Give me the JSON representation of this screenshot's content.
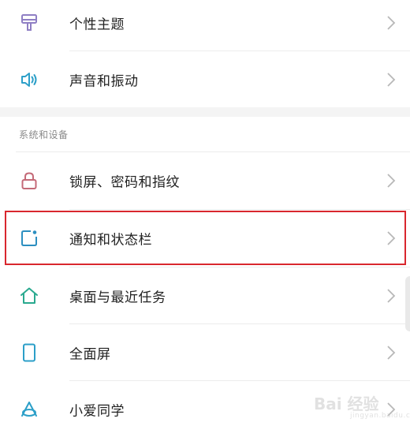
{
  "section_top": {
    "items": [
      {
        "label": "个性主题",
        "icon": "theme-icon"
      },
      {
        "label": "声音和振动",
        "icon": "sound-icon"
      }
    ]
  },
  "section_system": {
    "header": "系统和设备",
    "items": [
      {
        "label": "锁屏、密码和指纹",
        "icon": "lock-icon"
      },
      {
        "label": "通知和状态栏",
        "icon": "notification-icon"
      },
      {
        "label": "桌面与最近任务",
        "icon": "home-icon"
      },
      {
        "label": "全面屏",
        "icon": "phone-icon"
      },
      {
        "label": "小爱同学",
        "icon": "xiaoai-icon"
      }
    ]
  },
  "watermark": {
    "text": "Bai 经验",
    "sub": "jingyan.baidu.com"
  },
  "colors": {
    "highlight": "#d9272e",
    "theme_icon": "#8f7fc4",
    "sound_icon": "#2c9fc8",
    "lock_icon": "#c46a78",
    "notification_icon": "#2c8fc0",
    "home_icon": "#2aa98f",
    "phone_icon": "#2c9fc8",
    "xiaoai_icon": "#2c9fc8"
  }
}
